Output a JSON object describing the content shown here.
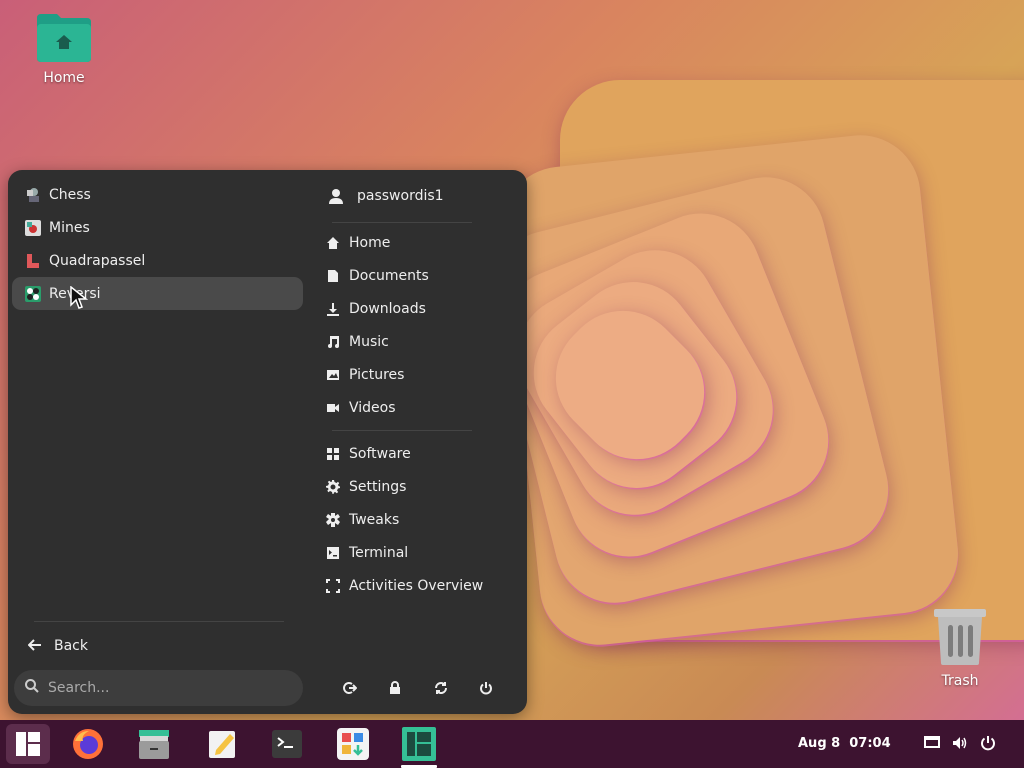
{
  "desktop": {
    "home_label": "Home",
    "trash_label": "Trash"
  },
  "menu": {
    "apps": [
      {
        "label": "Chess",
        "icon": "chess-icon"
      },
      {
        "label": "Mines",
        "icon": "mines-icon"
      },
      {
        "label": "Quadrapassel",
        "icon": "quadrapassel-icon"
      },
      {
        "label": "Reversi",
        "icon": "reversi-icon",
        "active": true
      }
    ],
    "back_label": "Back",
    "search_placeholder": "Search...",
    "user": {
      "name": "passwordis1",
      "icon": "user-icon"
    },
    "places": [
      {
        "label": "Home",
        "icon": "home-icon"
      },
      {
        "label": "Documents",
        "icon": "document-icon"
      },
      {
        "label": "Downloads",
        "icon": "download-icon"
      },
      {
        "label": "Music",
        "icon": "music-icon"
      },
      {
        "label": "Pictures",
        "icon": "picture-icon"
      },
      {
        "label": "Videos",
        "icon": "video-icon"
      }
    ],
    "system": [
      {
        "label": "Software",
        "icon": "software-icon"
      },
      {
        "label": "Settings",
        "icon": "gear-icon"
      },
      {
        "label": "Tweaks",
        "icon": "tweaks-icon"
      },
      {
        "label": "Terminal",
        "icon": "terminal-icon"
      },
      {
        "label": "Activities Overview",
        "icon": "activities-icon"
      }
    ],
    "power_actions": [
      "logout-icon",
      "lock-icon",
      "restart-icon",
      "power-icon"
    ]
  },
  "taskbar": {
    "apps": [
      "manjaro-icon",
      "firefox-icon",
      "files-icon",
      "text-editor-icon",
      "terminal-icon",
      "software-icon",
      "manjaro-settings-icon"
    ],
    "clock_date": "Aug 8",
    "clock_time": "07:04",
    "tray": [
      "screen-icon",
      "volume-icon",
      "power-icon"
    ]
  },
  "colors": {
    "menu_bg": "#2f2f2f",
    "active_item": "#4a4a4a",
    "taskbar_bg": "#3d1330",
    "accent": "#35bf96"
  }
}
